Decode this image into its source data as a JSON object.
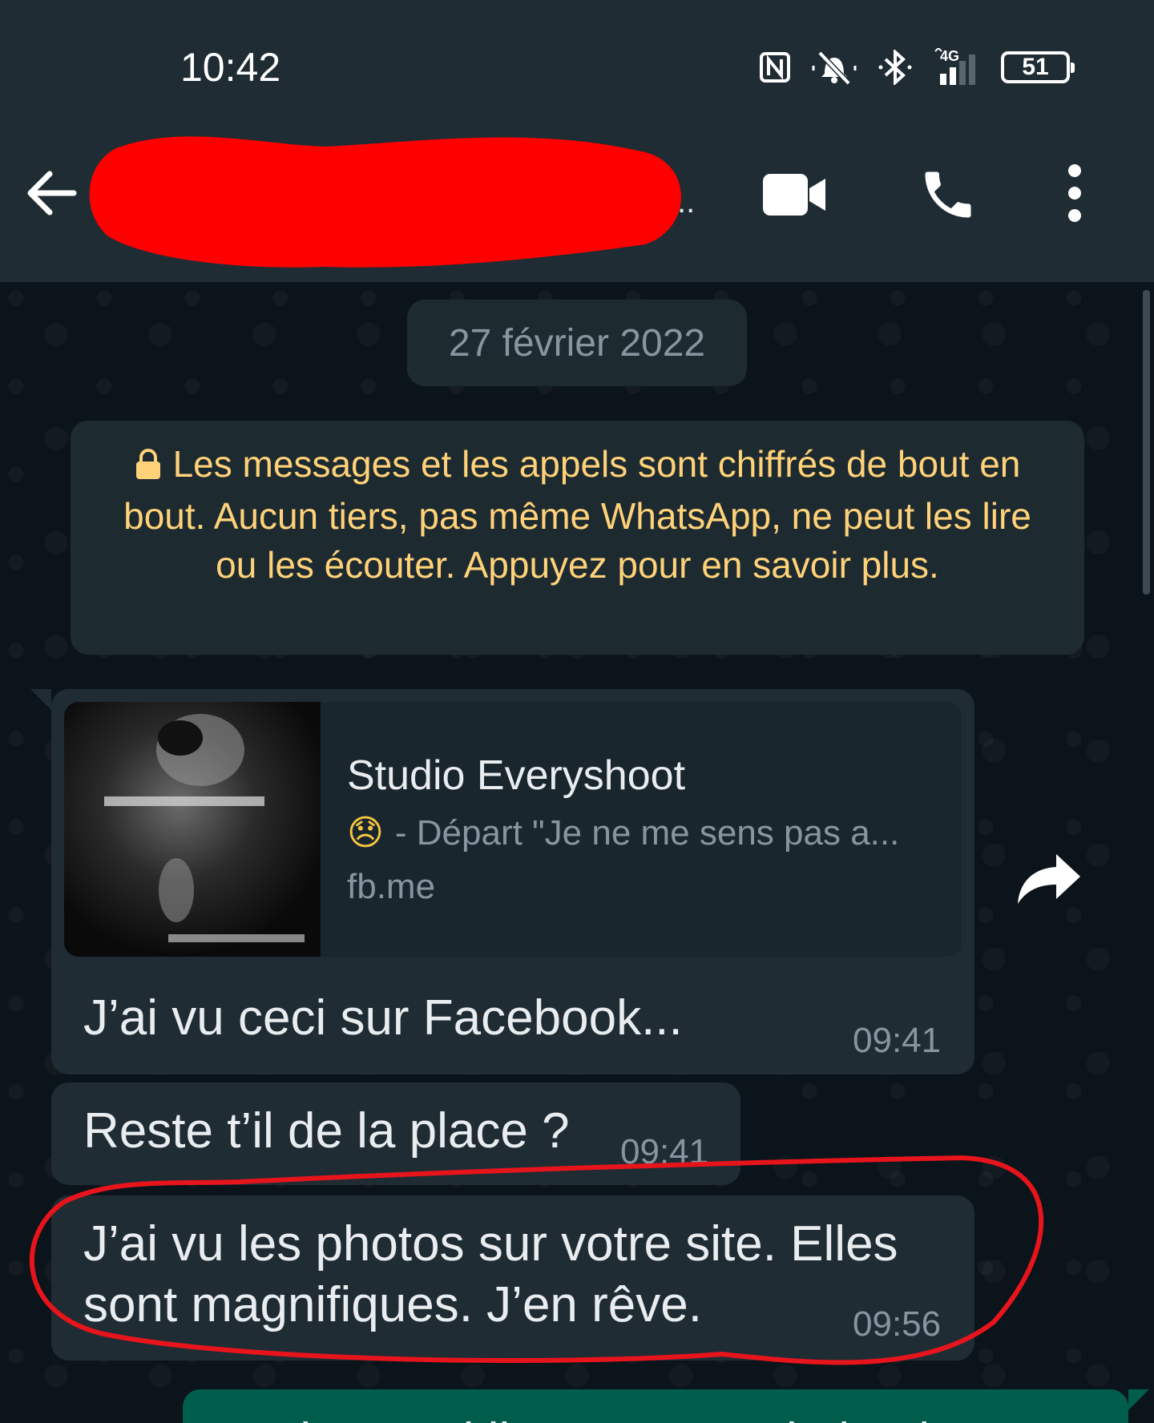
{
  "status_bar": {
    "time": "10:42",
    "icons": [
      "nfc-icon",
      "vibrate-off-icon",
      "bluetooth-icon",
      "signal-4g-icon"
    ],
    "network_label": "4G",
    "battery_level": "51"
  },
  "header": {
    "contact_name": "",
    "contact_name_redacted": true,
    "ellipsis": "..",
    "actions": [
      "video-call-icon",
      "voice-call-icon",
      "more-options-icon"
    ]
  },
  "chat": {
    "date_chip": "27 février 2022",
    "encryption_notice": "Les messages et les appels sont chiffrés de bout en bout. Aucun tiers, pas même WhatsApp, ne peut les lire ou les écouter. Appuyez pour en savoir plus.",
    "messages": [
      {
        "link_preview": {
          "title": "Studio Everyshoot",
          "emoji": "😞",
          "description": "- Départ \"Je ne me sens pas a...",
          "domain": "fb.me"
        },
        "text": "J’ai vu ceci sur Facebook...",
        "time": "09:41"
      },
      {
        "text": "Reste t’il de la place ?",
        "time": "09:41"
      },
      {
        "text_line1": "J’ai vu les photos sur votre site. Elles",
        "text_line2": "sont magnifiques. J’en rêve.",
        "time": "09:56"
      },
      {
        "text": "Bonjour, oui il nous reste de la place",
        "outgoing": true
      }
    ]
  },
  "colors": {
    "bar_bg": "#1f2c34",
    "chat_bg": "#0b141a",
    "incoming_bubble": "#1f2c34",
    "outgoing_bubble": "#005c4b",
    "notice_text": "#ffd279",
    "annotation_red": "#e8141c"
  }
}
